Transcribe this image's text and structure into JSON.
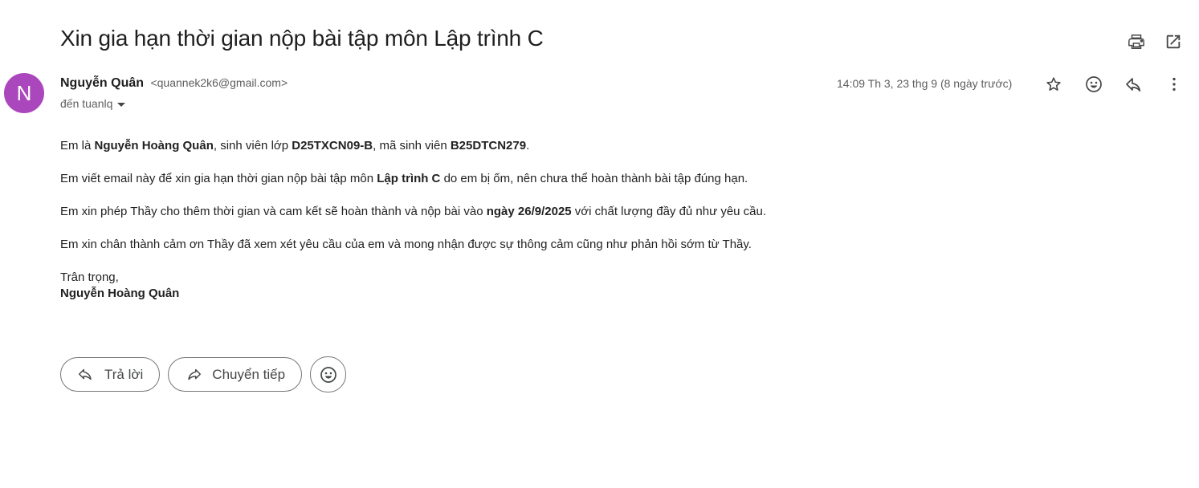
{
  "subject": "Xin gia hạn thời gian nộp bài tập môn Lập trình C",
  "header_icons": {
    "print": "print-icon",
    "open_new_window": "open-in-new-icon"
  },
  "sender": {
    "avatar_letter": "N",
    "avatar_color": "#ab47bc",
    "name": "Nguyễn Quân",
    "email": "<quannek2k6@gmail.com>",
    "to": "đến tuanlq"
  },
  "date": "14:09 Th 3, 23 thg 9 (8 ngày trước)",
  "message_icons": [
    "star-icon",
    "emoji-icon",
    "reply-icon",
    "more-vert-icon"
  ],
  "body": {
    "p1": {
      "a": "Em là ",
      "b": "Nguyễn Hoàng Quân",
      "c": ", sinh viên lớp ",
      "d": "D25TXCN09-B",
      "e": ", mã sinh viên ",
      "f": "B25DTCN279",
      "g": "."
    },
    "p2": {
      "a": "Em viết email này để xin gia hạn thời gian nộp bài tập môn ",
      "b": "Lập trình C",
      "c": " do em bị ốm, nên chưa thể hoàn thành bài tập đúng hạn."
    },
    "p3": {
      "a": "Em xin phép Thầy cho thêm thời gian và cam kết sẽ hoàn thành và nộp bài vào ",
      "b": "ngày 26/9/2025",
      "c": " với chất lượng đầy đủ như yêu cầu."
    },
    "p4": "Em xin chân thành cảm ơn Thầy đã xem xét yêu cầu của em và mong nhận được sự thông cảm cũng như phản hồi sớm từ Thầy.",
    "closing": "Trân trọng,",
    "signature": "Nguyễn Hoàng Quân"
  },
  "actions": {
    "reply": "Trả lời",
    "forward": "Chuyển tiếp"
  }
}
